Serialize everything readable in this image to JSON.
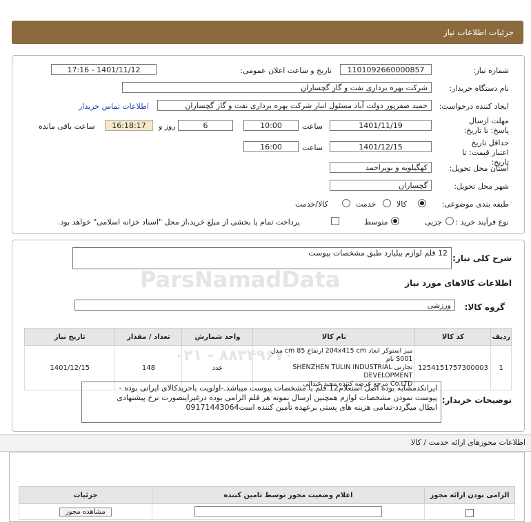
{
  "header": {
    "title": "جزئیات اطلاعات نیاز"
  },
  "form": {
    "need_no_label": "شماره نیاز:",
    "need_no": "1101092660000857",
    "announce_label": "تاریخ و ساعت اعلان عمومی:",
    "announce_value": "1401/11/12 - 17:16",
    "buyer_label": "نام دستگاه خریدار:",
    "buyer_value": "شرکت بهره برداری نفت و گاز گچساران",
    "creator_label": "ایجاد کننده درخواست:",
    "creator_value": "حمید  صفرپور دولت آباد مسئول انبار شرکت بهره برداری نفت و گاز گچساران",
    "contact_link": "اطلاعات تماس خریدار",
    "deadline_label": "مهلت ارسال پاسخ: تا تاریخ:",
    "deadline_date": "1401/11/19",
    "time_word": "ساعت",
    "deadline_time": "10:00",
    "days_value": "6",
    "days_word": "روز و",
    "remaining_time": "16:18:17",
    "remaining_word": "ساعت باقی مانده",
    "validity_label": "حداقل تاریخ اعتبار قیمت: تا تاریخ:",
    "validity_date": "1401/12/15",
    "validity_time": "16:00",
    "province_label": "استان محل تحویل:",
    "province_value": "کهگیلویه و بویراحمد",
    "city_label": "شهر محل تحویل:",
    "city_value": "گچساران",
    "category_label": "طبقه بندی موضوعی:",
    "cat_options": [
      "کالا",
      "خدمت",
      "کالا/خدمت"
    ],
    "cat_selected": 0,
    "process_label": "نوع فرآیند خرید :",
    "proc_options": [
      "جزیی",
      "متوسط"
    ],
    "proc_selected": 1,
    "payment_text": "پرداخت تمام یا بخشی از مبلغ خرید،از محل \"اسناد خزانه اسلامی\" خواهد بود."
  },
  "summary": {
    "label": "شرح کلی نیاز:",
    "value": "12 قلم لوازم بیلیارد طبق مشخصات پیوست",
    "goods_info_title": "اطلاعات کالاهای مورد نیاز",
    "group_label": "گروه کالا:",
    "group_value": "ورزشی"
  },
  "goods_table": {
    "headers": [
      "ردیف",
      "کد کالا",
      "نام کالا",
      "واحد شمارش",
      "تعداد / مقدار",
      "تاریخ نیاز"
    ],
    "rows": [
      {
        "row": "1",
        "code": "1254151757300003",
        "name_l1": "میز اسنوکر ابعاد 204x415 cm ارتفاع 85 cm مدل S001 نام",
        "name_l2": "تجارتی SHENZHEN TULIN INDUSTRIAL DEVELOPMENT",
        "name_l3": "Co.LTD مرجع عرضه کننده مجید عبدالی",
        "unit": "عدد",
        "qty": "148",
        "date": "1401/12/15"
      }
    ]
  },
  "buyer_notes": {
    "label": "توضیحات خریدار:",
    "lines": [
      "ایرانکدمشابه بوده اصل استعلام12 قلم با مشخصات پیوست میباشد.-اولویت باخریدکالای ایرانی بوده -",
      "پیوست نمودن مشخصات لوازم همچنین ارسال نمونه هر قلم الزامی بوده درغیراینصورت نرخ پیشنهادی",
      "ابطال میگردد-تمامی هزینه های پستی برعهده تأمین کننده است09171443064"
    ]
  },
  "permits": {
    "title": "اطلاعات مجوزهای ارائه خدمت / کالا",
    "headers": [
      "الزامی بودن ارائه مجوز",
      "اعلام وضعیت مجوز توسط تامین کننده",
      "جزئیات"
    ],
    "view_button": "مشاهده مجوز"
  },
  "watermark": {
    "main": "ParsNamadData",
    "phone": "۰۲۱ - ۸۸۳۴۹۶۷۰"
  }
}
